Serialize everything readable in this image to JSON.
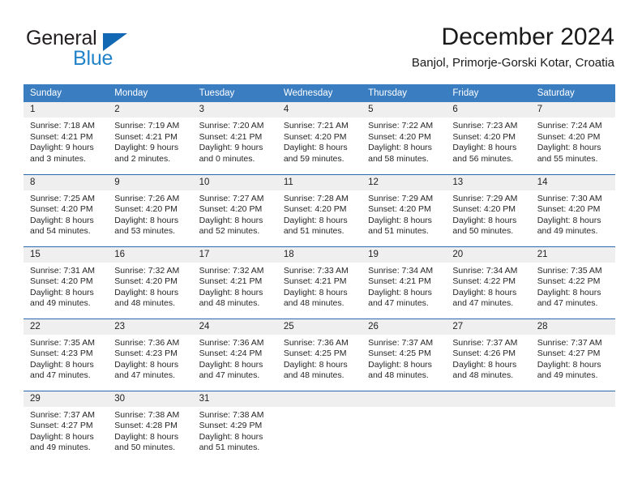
{
  "brand": {
    "name_top": "General",
    "name_bottom": "Blue",
    "color_dark": "#231f20",
    "color_blue": "#2283c8",
    "triangle_color": "#1368b4"
  },
  "header": {
    "title": "December 2024",
    "subtitle": "Banjol, Primorje-Gorski Kotar, Croatia"
  },
  "theme": {
    "header_row_bg": "#3a7dc0",
    "header_row_text": "#ffffff",
    "daynum_bg": "#efefef",
    "row_rule": "#2a69ae"
  },
  "calendar": {
    "weekday_headers": [
      "Sunday",
      "Monday",
      "Tuesday",
      "Wednesday",
      "Thursday",
      "Friday",
      "Saturday"
    ],
    "weeks": [
      [
        {
          "day": "1",
          "sunrise": "Sunrise: 7:18 AM",
          "sunset": "Sunset: 4:21 PM",
          "daylight1": "Daylight: 9 hours",
          "daylight2": "and 3 minutes."
        },
        {
          "day": "2",
          "sunrise": "Sunrise: 7:19 AM",
          "sunset": "Sunset: 4:21 PM",
          "daylight1": "Daylight: 9 hours",
          "daylight2": "and 2 minutes."
        },
        {
          "day": "3",
          "sunrise": "Sunrise: 7:20 AM",
          "sunset": "Sunset: 4:21 PM",
          "daylight1": "Daylight: 9 hours",
          "daylight2": "and 0 minutes."
        },
        {
          "day": "4",
          "sunrise": "Sunrise: 7:21 AM",
          "sunset": "Sunset: 4:20 PM",
          "daylight1": "Daylight: 8 hours",
          "daylight2": "and 59 minutes."
        },
        {
          "day": "5",
          "sunrise": "Sunrise: 7:22 AM",
          "sunset": "Sunset: 4:20 PM",
          "daylight1": "Daylight: 8 hours",
          "daylight2": "and 58 minutes."
        },
        {
          "day": "6",
          "sunrise": "Sunrise: 7:23 AM",
          "sunset": "Sunset: 4:20 PM",
          "daylight1": "Daylight: 8 hours",
          "daylight2": "and 56 minutes."
        },
        {
          "day": "7",
          "sunrise": "Sunrise: 7:24 AM",
          "sunset": "Sunset: 4:20 PM",
          "daylight1": "Daylight: 8 hours",
          "daylight2": "and 55 minutes."
        }
      ],
      [
        {
          "day": "8",
          "sunrise": "Sunrise: 7:25 AM",
          "sunset": "Sunset: 4:20 PM",
          "daylight1": "Daylight: 8 hours",
          "daylight2": "and 54 minutes."
        },
        {
          "day": "9",
          "sunrise": "Sunrise: 7:26 AM",
          "sunset": "Sunset: 4:20 PM",
          "daylight1": "Daylight: 8 hours",
          "daylight2": "and 53 minutes."
        },
        {
          "day": "10",
          "sunrise": "Sunrise: 7:27 AM",
          "sunset": "Sunset: 4:20 PM",
          "daylight1": "Daylight: 8 hours",
          "daylight2": "and 52 minutes."
        },
        {
          "day": "11",
          "sunrise": "Sunrise: 7:28 AM",
          "sunset": "Sunset: 4:20 PM",
          "daylight1": "Daylight: 8 hours",
          "daylight2": "and 51 minutes."
        },
        {
          "day": "12",
          "sunrise": "Sunrise: 7:29 AM",
          "sunset": "Sunset: 4:20 PM",
          "daylight1": "Daylight: 8 hours",
          "daylight2": "and 51 minutes."
        },
        {
          "day": "13",
          "sunrise": "Sunrise: 7:29 AM",
          "sunset": "Sunset: 4:20 PM",
          "daylight1": "Daylight: 8 hours",
          "daylight2": "and 50 minutes."
        },
        {
          "day": "14",
          "sunrise": "Sunrise: 7:30 AM",
          "sunset": "Sunset: 4:20 PM",
          "daylight1": "Daylight: 8 hours",
          "daylight2": "and 49 minutes."
        }
      ],
      [
        {
          "day": "15",
          "sunrise": "Sunrise: 7:31 AM",
          "sunset": "Sunset: 4:20 PM",
          "daylight1": "Daylight: 8 hours",
          "daylight2": "and 49 minutes."
        },
        {
          "day": "16",
          "sunrise": "Sunrise: 7:32 AM",
          "sunset": "Sunset: 4:20 PM",
          "daylight1": "Daylight: 8 hours",
          "daylight2": "and 48 minutes."
        },
        {
          "day": "17",
          "sunrise": "Sunrise: 7:32 AM",
          "sunset": "Sunset: 4:21 PM",
          "daylight1": "Daylight: 8 hours",
          "daylight2": "and 48 minutes."
        },
        {
          "day": "18",
          "sunrise": "Sunrise: 7:33 AM",
          "sunset": "Sunset: 4:21 PM",
          "daylight1": "Daylight: 8 hours",
          "daylight2": "and 48 minutes."
        },
        {
          "day": "19",
          "sunrise": "Sunrise: 7:34 AM",
          "sunset": "Sunset: 4:21 PM",
          "daylight1": "Daylight: 8 hours",
          "daylight2": "and 47 minutes."
        },
        {
          "day": "20",
          "sunrise": "Sunrise: 7:34 AM",
          "sunset": "Sunset: 4:22 PM",
          "daylight1": "Daylight: 8 hours",
          "daylight2": "and 47 minutes."
        },
        {
          "day": "21",
          "sunrise": "Sunrise: 7:35 AM",
          "sunset": "Sunset: 4:22 PM",
          "daylight1": "Daylight: 8 hours",
          "daylight2": "and 47 minutes."
        }
      ],
      [
        {
          "day": "22",
          "sunrise": "Sunrise: 7:35 AM",
          "sunset": "Sunset: 4:23 PM",
          "daylight1": "Daylight: 8 hours",
          "daylight2": "and 47 minutes."
        },
        {
          "day": "23",
          "sunrise": "Sunrise: 7:36 AM",
          "sunset": "Sunset: 4:23 PM",
          "daylight1": "Daylight: 8 hours",
          "daylight2": "and 47 minutes."
        },
        {
          "day": "24",
          "sunrise": "Sunrise: 7:36 AM",
          "sunset": "Sunset: 4:24 PM",
          "daylight1": "Daylight: 8 hours",
          "daylight2": "and 47 minutes."
        },
        {
          "day": "25",
          "sunrise": "Sunrise: 7:36 AM",
          "sunset": "Sunset: 4:25 PM",
          "daylight1": "Daylight: 8 hours",
          "daylight2": "and 48 minutes."
        },
        {
          "day": "26",
          "sunrise": "Sunrise: 7:37 AM",
          "sunset": "Sunset: 4:25 PM",
          "daylight1": "Daylight: 8 hours",
          "daylight2": "and 48 minutes."
        },
        {
          "day": "27",
          "sunrise": "Sunrise: 7:37 AM",
          "sunset": "Sunset: 4:26 PM",
          "daylight1": "Daylight: 8 hours",
          "daylight2": "and 48 minutes."
        },
        {
          "day": "28",
          "sunrise": "Sunrise: 7:37 AM",
          "sunset": "Sunset: 4:27 PM",
          "daylight1": "Daylight: 8 hours",
          "daylight2": "and 49 minutes."
        }
      ],
      [
        {
          "day": "29",
          "sunrise": "Sunrise: 7:37 AM",
          "sunset": "Sunset: 4:27 PM",
          "daylight1": "Daylight: 8 hours",
          "daylight2": "and 49 minutes."
        },
        {
          "day": "30",
          "sunrise": "Sunrise: 7:38 AM",
          "sunset": "Sunset: 4:28 PM",
          "daylight1": "Daylight: 8 hours",
          "daylight2": "and 50 minutes."
        },
        {
          "day": "31",
          "sunrise": "Sunrise: 7:38 AM",
          "sunset": "Sunset: 4:29 PM",
          "daylight1": "Daylight: 8 hours",
          "daylight2": "and 51 minutes."
        },
        {
          "day": "",
          "sunrise": "",
          "sunset": "",
          "daylight1": "",
          "daylight2": ""
        },
        {
          "day": "",
          "sunrise": "",
          "sunset": "",
          "daylight1": "",
          "daylight2": ""
        },
        {
          "day": "",
          "sunrise": "",
          "sunset": "",
          "daylight1": "",
          "daylight2": ""
        },
        {
          "day": "",
          "sunrise": "",
          "sunset": "",
          "daylight1": "",
          "daylight2": ""
        }
      ]
    ]
  }
}
